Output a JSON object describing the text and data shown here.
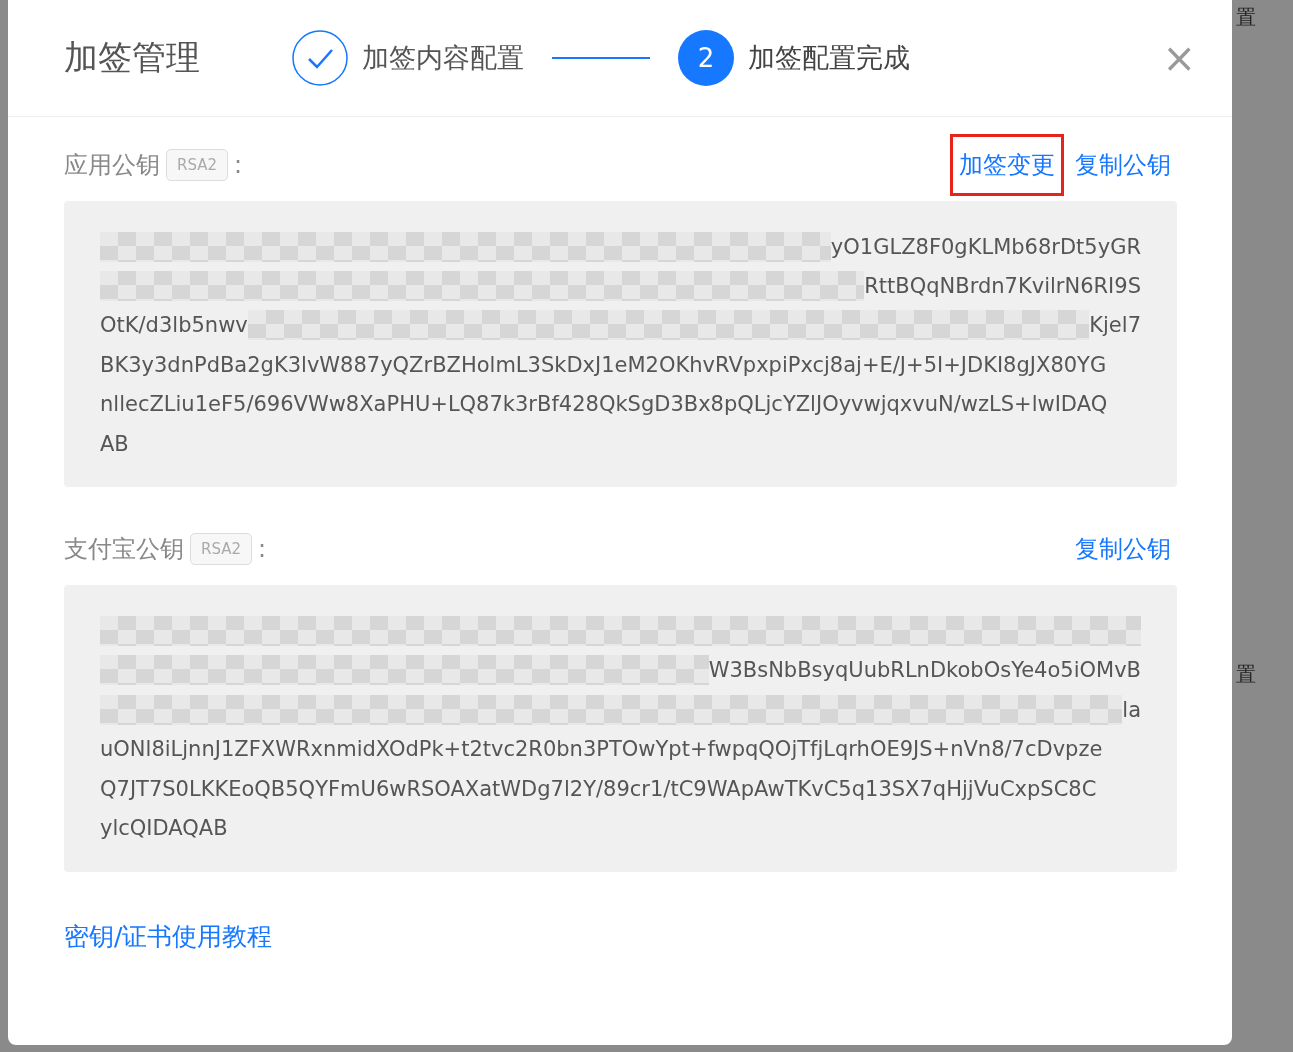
{
  "background": {
    "texts": [
      "置",
      "置"
    ]
  },
  "dialog": {
    "title": "加签管理",
    "steps": [
      {
        "kind": "done",
        "label": "加签内容配置"
      },
      {
        "kind": "current",
        "number": "2",
        "label": "加签配置完成"
      }
    ],
    "close": "×",
    "sections": [
      {
        "label": "应用公钥",
        "tag": "RSA2",
        "colon": ":",
        "actions": [
          {
            "label": "加签变更",
            "highlighted": true
          },
          {
            "label": "复制公钥",
            "highlighted": false
          }
        ],
        "lines": [
          {
            "masked": true,
            "after": "yO1GLZ8F0gKLMb68rDt5yGR"
          },
          {
            "masked": true,
            "after": "RttBQqNBrdn7KvilrN6RI9S"
          },
          {
            "before": "OtK/d3lb5nwv",
            "masked": true,
            "after": "Kjel7"
          },
          {
            "before": "BK3y3dnPdBa2gK3lvW887yQZrBZHolmL3SkDxJ1eM2OKhvRVpxpiPxcj8aj+E/J+5I+JDKI8gJX80YG"
          },
          {
            "before": "nllecZLiu1eF5/696VWw8XaPHU+LQ87k3rBf428QkSgD3Bx8pQLjcYZlJOyvwjqxvuN/wzLS+lwIDAQ"
          },
          {
            "before": "AB"
          }
        ]
      },
      {
        "label": "支付宝公钥",
        "tag": "RSA2",
        "colon": ":",
        "actions": [
          {
            "label": "复制公钥",
            "highlighted": false
          }
        ],
        "lines": [
          {
            "masked": true
          },
          {
            "masked": true,
            "after": "W3BsNbBsyqUubRLnDkobOsYe4o5iOMvB"
          },
          {
            "masked": true,
            "after": "la"
          },
          {
            "before": "uONl8iLjnnJ1ZFXWRxnmidXOdPk+t2tvc2R0bn3PTOwYpt+fwpqQOjTfjLqrhOE9JS+nVn8/7cDvpze"
          },
          {
            "before": "Q7JT7S0LKKEoQB5QYFmU6wRSOAXatWDg7l2Y/89cr1/tC9WApAwTKvC5q13SX7qHjjVuCxpSC8C"
          },
          {
            "before": "ylcQIDAQAB"
          }
        ]
      }
    ],
    "footer_link": "密钥/证书使用教程"
  }
}
